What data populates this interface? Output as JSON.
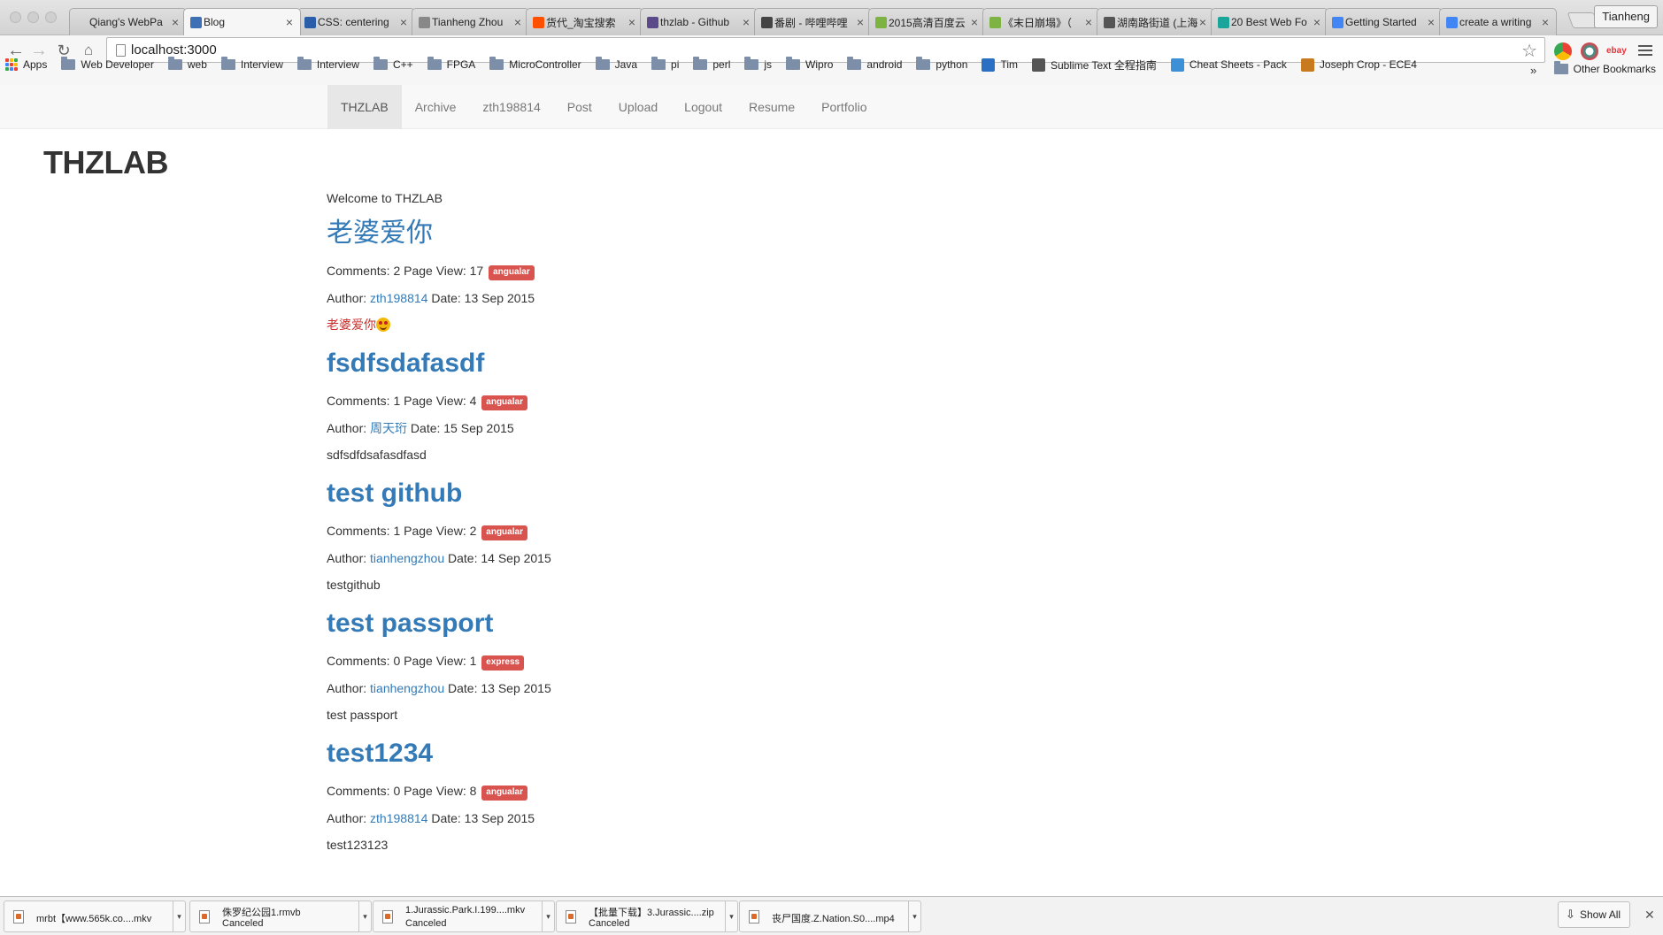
{
  "browser": {
    "tabs": [
      {
        "label": "Qiang's WebPa",
        "favicon": "blank-icon",
        "color": "transparent",
        "active": false
      },
      {
        "label": "Blog",
        "favicon": "angle-brackets-icon",
        "color": "#3f6fb5",
        "active": true
      },
      {
        "label": "CSS: centering",
        "favicon": "w3c-icon",
        "color": "#2a5ea8",
        "active": false
      },
      {
        "label": "Tianheng Zhou",
        "favicon": "page-icon",
        "color": "#888888",
        "active": false
      },
      {
        "label": "货代_淘宝搜索",
        "favicon": "taobao-icon",
        "color": "#ff5000",
        "active": false
      },
      {
        "label": "thzlab - Github",
        "favicon": "heroku-icon",
        "color": "#5a4a8a",
        "active": false
      },
      {
        "label": "番剧 - 哔哩哔哩",
        "favicon": "tv-icon",
        "color": "#444444",
        "active": false
      },
      {
        "label": "2015高清百度云",
        "favicon": "s-icon",
        "color": "#7cb342",
        "active": false
      },
      {
        "label": "《末日崩塌》（",
        "favicon": "s-icon",
        "color": "#7cb342",
        "active": false
      },
      {
        "label": "湖南路街道 (上海",
        "favicon": "wikipedia-icon",
        "color": "#555555",
        "active": false
      },
      {
        "label": "20 Best Web Fo",
        "favicon": "square-icon",
        "color": "#1aa59a",
        "active": false
      },
      {
        "label": "Getting Started",
        "favicon": "loading-icon",
        "color": "#4285f4",
        "active": false
      },
      {
        "label": "create a writing",
        "favicon": "google-icon",
        "color": "#4285f4",
        "active": false
      }
    ],
    "profile_name": "Tianheng",
    "url": "localhost:3000",
    "bookmarks": [
      {
        "label": "Apps",
        "type": "apps"
      },
      {
        "label": "Web Developer",
        "type": "folder"
      },
      {
        "label": "web",
        "type": "folder"
      },
      {
        "label": "Interview",
        "type": "folder"
      },
      {
        "label": "Interview",
        "type": "folder"
      },
      {
        "label": "C++",
        "type": "folder"
      },
      {
        "label": "FPGA",
        "type": "folder"
      },
      {
        "label": "MicroController",
        "type": "folder"
      },
      {
        "label": "Java",
        "type": "folder"
      },
      {
        "label": "pi",
        "type": "folder"
      },
      {
        "label": "perl",
        "type": "folder"
      },
      {
        "label": "js",
        "type": "folder"
      },
      {
        "label": "Wipro",
        "type": "folder"
      },
      {
        "label": "android",
        "type": "folder"
      },
      {
        "label": "python",
        "type": "folder"
      },
      {
        "label": "Tim",
        "type": "trello"
      },
      {
        "label": "Sublime Text 全程指南",
        "type": "sublime"
      },
      {
        "label": "Cheat Sheets - Pack",
        "type": "cheat"
      },
      {
        "label": "Joseph Crop - ECE4",
        "type": "joseph"
      }
    ],
    "bookmarks_overflow": "»",
    "other_bookmarks": "Other Bookmarks"
  },
  "site": {
    "nav": [
      "THZLAB",
      "Archive",
      "zth198814",
      "Post",
      "Upload",
      "Logout",
      "Resume",
      "Portfolio"
    ],
    "brand": "THZLAB",
    "welcome": "Welcome to THZLAB",
    "posts": [
      {
        "title": "老婆爱你",
        "comments": "Comments: 2",
        "views": "Page View: 17",
        "tag": "angualar",
        "author_prefix": "Author:",
        "author": "zth198814",
        "date": "Date: 13 Sep 2015",
        "content": "老婆爱你"
      },
      {
        "title": "fsdfsdafasdf",
        "comments": "Comments: 1",
        "views": "Page View: 4",
        "tag": "angualar",
        "author_prefix": "Author:",
        "author": "周天珩",
        "date": "Date: 15 Sep 2015",
        "content": "sdfsdfdsafasdfasd"
      },
      {
        "title": "test github",
        "comments": "Comments: 1",
        "views": "Page View: 2",
        "tag": "angualar",
        "author_prefix": "Author:",
        "author": "tianhengzhou",
        "date": "Date: 14 Sep 2015",
        "content": "testgithub"
      },
      {
        "title": "test passport",
        "comments": "Comments: 0",
        "views": "Page View: 1",
        "tag": "express",
        "author_prefix": "Author:",
        "author": "tianhengzhou",
        "date": "Date: 13 Sep 2015",
        "content": "test passport"
      },
      {
        "title": "test1234",
        "comments": "Comments: 0",
        "views": "Page View: 8",
        "tag": "angualar",
        "author_prefix": "Author:",
        "author": "zth198814",
        "date": "Date: 13 Sep 2015",
        "content": "test123123"
      }
    ]
  },
  "downloads": {
    "items": [
      {
        "name": "mrbt【www.565k.co....mkv",
        "status": ""
      },
      {
        "name": "侏罗纪公园1.rmvb",
        "status": "Canceled"
      },
      {
        "name": "1.Jurassic.Park.I.199....mkv",
        "status": "Canceled"
      },
      {
        "name": "【批量下载】3.Jurassic....zip",
        "status": "Canceled"
      },
      {
        "name": "丧尸国度.Z.Nation.S0....mp4",
        "status": ""
      }
    ],
    "show_all": "Show All"
  },
  "colors": {
    "link": "#337ab7",
    "label": "#d9534f",
    "post_content_highlight": "#c9302c"
  }
}
